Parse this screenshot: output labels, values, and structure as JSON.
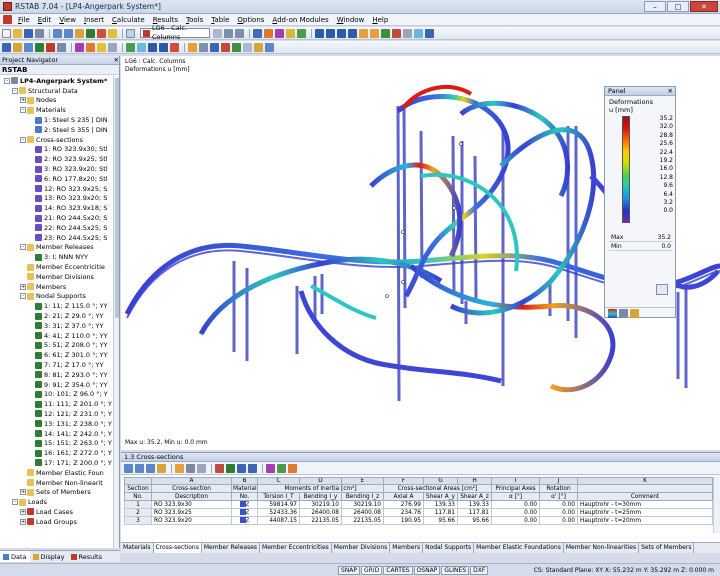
{
  "window": {
    "title": "RSTAB 7.04 - [LP4-Angerpark System*]",
    "min": "–",
    "max": "□",
    "close": "✕"
  },
  "menu": [
    "File",
    "Edit",
    "View",
    "Insert",
    "Calculate",
    "Results",
    "Tools",
    "Table",
    "Options",
    "Add-on Modules",
    "Window",
    "Help"
  ],
  "toolbar": {
    "load_case": "LG6 - Calc. Columns"
  },
  "navigator": {
    "title": "Project Navigator",
    "root": "RSTAB",
    "project": "LP4-Angerpark System*",
    "items": [
      {
        "level": 2,
        "label": "Structural Data",
        "icon": "folder-icon",
        "toggle": "-"
      },
      {
        "level": 3,
        "label": "Nodes",
        "icon": "folder-icon",
        "toggle": "+"
      },
      {
        "level": 3,
        "label": "Materials",
        "icon": "folder-icon",
        "toggle": "-"
      },
      {
        "level": 4,
        "label": "1: Steel S 235 | DIN",
        "icon": "material-icon"
      },
      {
        "level": 4,
        "label": "2: Steel S 355 | DIN",
        "icon": "material-icon"
      },
      {
        "level": 3,
        "label": "Cross-sections",
        "icon": "folder-icon",
        "toggle": "-"
      },
      {
        "level": 4,
        "label": "1: RO 323.9x30; Stl",
        "icon": "section-icon"
      },
      {
        "level": 4,
        "label": "2: RO 323.9x25; Stl",
        "icon": "section-icon"
      },
      {
        "level": 4,
        "label": "3: RO 323.9x20; Stl",
        "icon": "section-icon"
      },
      {
        "level": 4,
        "label": "6: RO 177.8x20; Stl",
        "icon": "section-icon"
      },
      {
        "level": 4,
        "label": "12: RO 323.9x25; S",
        "icon": "section-icon"
      },
      {
        "level": 4,
        "label": "13: RO 323.9x20; S",
        "icon": "section-icon"
      },
      {
        "level": 4,
        "label": "14: RO 323.9x18; S",
        "icon": "section-icon"
      },
      {
        "level": 4,
        "label": "21: RO 244.5x20; S",
        "icon": "section-icon"
      },
      {
        "level": 4,
        "label": "22: RO 244.5x25; S",
        "icon": "section-icon"
      },
      {
        "level": 4,
        "label": "23: RO 244.5x25; S",
        "icon": "section-icon"
      },
      {
        "level": 3,
        "label": "Member Releases",
        "icon": "folder-icon",
        "toggle": "-"
      },
      {
        "level": 4,
        "label": "3: I; NNN NYY",
        "icon": "release-icon"
      },
      {
        "level": 3,
        "label": "Member Eccentricitie",
        "icon": "folder-icon"
      },
      {
        "level": 3,
        "label": "Member Divisions",
        "icon": "folder-icon"
      },
      {
        "level": 3,
        "label": "Members",
        "icon": "folder-icon",
        "toggle": "+"
      },
      {
        "level": 3,
        "label": "Nodal Supports",
        "icon": "folder-icon",
        "toggle": "-"
      },
      {
        "level": 4,
        "label": "1: 11; Z 115.0 °; YY",
        "icon": "support-icon"
      },
      {
        "level": 4,
        "label": "2: 21; Z 29.0 °; YY",
        "icon": "support-icon"
      },
      {
        "level": 4,
        "label": "3: 31; Z 37.0 °; YY",
        "icon": "support-icon"
      },
      {
        "level": 4,
        "label": "4: 41; Z 110.0 °; YY",
        "icon": "support-icon"
      },
      {
        "level": 4,
        "label": "5: 51; Z 208.0 °; YY",
        "icon": "support-icon"
      },
      {
        "level": 4,
        "label": "6: 61; Z 301.0 °; YY",
        "icon": "support-icon"
      },
      {
        "level": 4,
        "label": "7: 71; Z 17.0 °; YY",
        "icon": "support-icon"
      },
      {
        "level": 4,
        "label": "8: 81; Z 293.0 °; YY",
        "icon": "support-icon"
      },
      {
        "level": 4,
        "label": "9: 91; Z 354.0 °; YY",
        "icon": "support-icon"
      },
      {
        "level": 4,
        "label": "10: 101; Z 96.0 °; Y",
        "icon": "support-icon"
      },
      {
        "level": 4,
        "label": "11: 111; Z 201.0 °; Y",
        "icon": "support-icon"
      },
      {
        "level": 4,
        "label": "12: 121; Z 231.0 °; Y",
        "icon": "support-icon"
      },
      {
        "level": 4,
        "label": "13: 131; Z 238.0 °; Y",
        "icon": "support-icon"
      },
      {
        "level": 4,
        "label": "14: 141; Z 242.0 °; Y",
        "icon": "support-icon"
      },
      {
        "level": 4,
        "label": "15: 151; Z 263.0 °; Y",
        "icon": "support-icon"
      },
      {
        "level": 4,
        "label": "16: 161; Z 272.0 °; Y",
        "icon": "support-icon"
      },
      {
        "level": 4,
        "label": "17: 171; Z 200.0 °; Y",
        "icon": "support-icon"
      },
      {
        "level": 3,
        "label": "Member Elastic Foun",
        "icon": "folder-icon"
      },
      {
        "level": 3,
        "label": "Member Non-linearit",
        "icon": "folder-icon"
      },
      {
        "level": 3,
        "label": "Sets of Members",
        "icon": "folder-icon",
        "toggle": "+"
      },
      {
        "level": 2,
        "label": "Loads",
        "icon": "folder-icon",
        "toggle": "-"
      },
      {
        "level": 3,
        "label": "Load Cases",
        "icon": "loadcase-icon",
        "toggle": "+"
      },
      {
        "level": 3,
        "label": "Load Groups",
        "icon": "loadcase-icon",
        "toggle": "+"
      }
    ],
    "tabs": [
      "Data",
      "Display",
      "Results"
    ]
  },
  "view": {
    "label_line1": "LG6 : Calc. Columns",
    "label_line2": "Deformations u [mm]",
    "bottom_text": "Max u: 35.2, Min u: 0.0 mm"
  },
  "panel": {
    "title": "Panel",
    "close": "✕",
    "heading1": "Deformations",
    "heading2": "u [mm]",
    "legend_values": [
      "35.2",
      "32.0",
      "28.8",
      "25.6",
      "22.4",
      "19.2",
      "16.0",
      "12.8",
      "9.6",
      "6.4",
      "3.2",
      "0.0"
    ],
    "max_label": "Max",
    "max_value": "35.2",
    "min_label": "Min",
    "min_value": "0.0"
  },
  "cross_sections": {
    "title": "1.3 Cross-sections",
    "column_letters": [
      "",
      "A",
      "B",
      "C",
      "D",
      "E",
      "F",
      "G",
      "H",
      "I",
      "J",
      "K"
    ],
    "header_row1": [
      "Section",
      "Cross-section",
      "Material",
      "Moments of Inertia [cm⁴]",
      "Cross-sectional Areas [cm²]",
      "Principal Axes",
      "Rotation",
      ""
    ],
    "header_row2": [
      "No.",
      "Description",
      "No.",
      "Torsion I_T",
      "Bending I_y",
      "Bending I_z",
      "Axial A",
      "Shear A_y",
      "Shear A_z",
      "α [°]",
      "α' [°]",
      "Comment"
    ],
    "rows": [
      [
        "1",
        "RO 323.9x30",
        "2",
        "59814.97",
        "30219.10",
        "30219.10",
        "276.99",
        "139.33",
        "139.33",
        "0.00",
        "0.00",
        "Hauptrohr - t=30mm"
      ],
      [
        "2",
        "RO 323.9x25",
        "2",
        "52433.36",
        "26400.08",
        "26400.08",
        "234.76",
        "117.81",
        "117.81",
        "0.00",
        "0.00",
        "Hauptrohr - t=25mm"
      ],
      [
        "3",
        "RO 323.9x20",
        "2",
        "44087.15",
        "22135.05",
        "22135.05",
        "190.95",
        "95.66",
        "95.66",
        "0.00",
        "0.00",
        "Hauptrohr - t=20mm"
      ]
    ],
    "tabs": [
      "Materials",
      "Cross-sections",
      "Member Releases",
      "Member Eccentricities",
      "Member Divisions",
      "Members",
      "Nodal Supports",
      "Member Elastic Foundations",
      "Member Non-linearities",
      "Sets of Members"
    ],
    "active_tab": 1
  },
  "status": {
    "toggles": [
      "SNAP",
      "GRID",
      "CARTES",
      "OSNAP",
      "GLINES",
      "DXF"
    ],
    "active": [
      1
    ],
    "coords": "CS: Standard  Plane: XY  X: 55.232 m  Y: 35.292 m  Z: 0.000 m"
  },
  "colors": {
    "track_low": "#3a3fd0",
    "track_mid": "#2cc7c0",
    "track_high": "#e11a10",
    "accent": "#c0392b"
  }
}
